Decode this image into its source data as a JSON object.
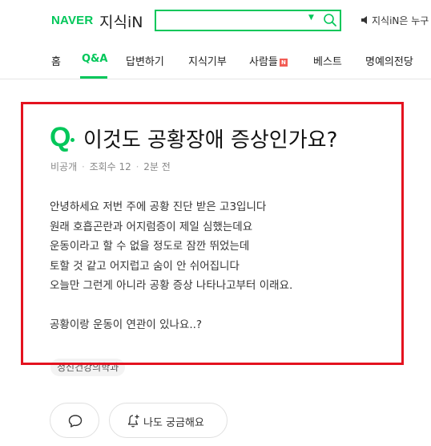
{
  "header": {
    "logo": "NAVER",
    "service": "지식iN",
    "search": {
      "value": "",
      "placeholder": ""
    },
    "notice": "지식iN은 누구"
  },
  "nav": {
    "items": [
      {
        "label": "홈"
      },
      {
        "label": "Q&A",
        "active": true
      },
      {
        "label": "답변하기"
      },
      {
        "label": "지식기부"
      },
      {
        "label": "사람들",
        "badge": "N"
      },
      {
        "label": "베스트"
      },
      {
        "label": "명예의전당"
      }
    ]
  },
  "question": {
    "mark": "Q",
    "title": "이것도 공황장애 증상인가요?",
    "author": "비공개",
    "views": "조회수 12",
    "time": "2분 전",
    "body": "안녕하세요 저번 주에 공황 진단 받은 고3입니다\n원래 호흡곤란과 어지럼증이 제일 심했는데요\n운동이라고 할 수 없을 정도로 잠깐 뛰었는데\n토할 것 같고 어지럽고 숨이 안 쉬어집니다\n오늘만 그런게 아니라 공황 증상 나타나고부터 이래요.\n\n공황이랑 운동이 연관이 있나요..?",
    "tag": "정신건강의학과"
  },
  "actions": {
    "curious_label": "나도 궁금해요"
  },
  "colors": {
    "brand": "#03c75a",
    "highlight": "#e4121f",
    "badge": "#f25c54"
  }
}
